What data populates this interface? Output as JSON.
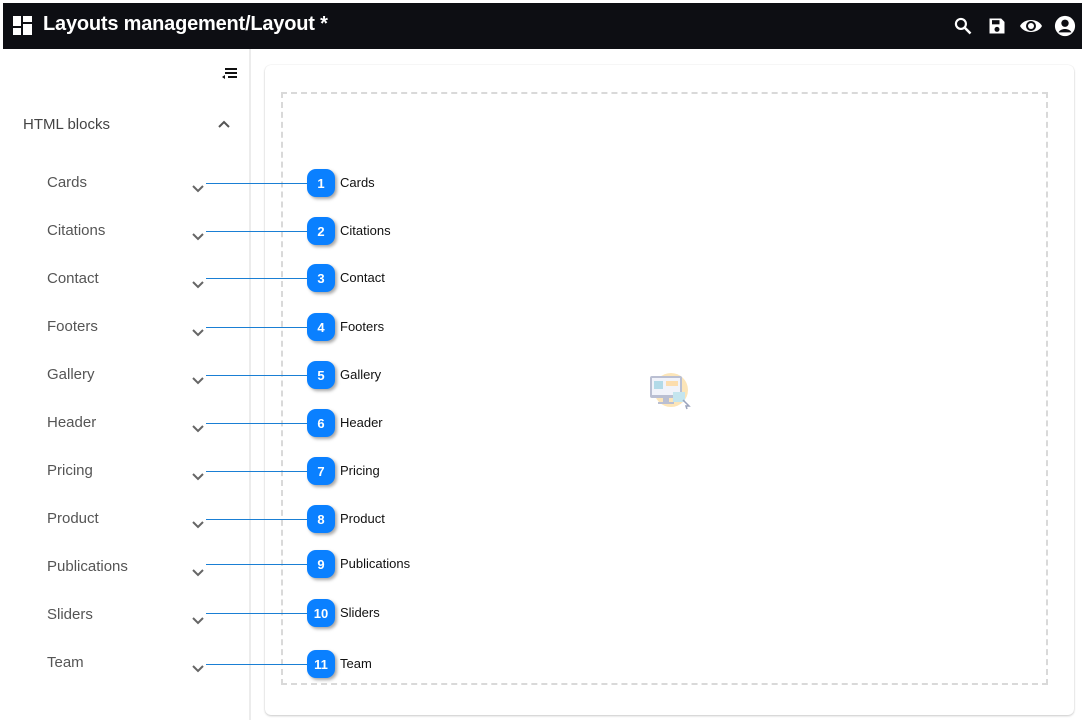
{
  "header": {
    "title": "Layouts management/Layout *",
    "icons": [
      "dashboard-icon",
      "search-icon",
      "save-icon",
      "preview-eye-icon",
      "account-icon"
    ]
  },
  "sidebar": {
    "group": {
      "label": "HTML blocks",
      "expanded": true
    },
    "items": [
      {
        "label": "Cards"
      },
      {
        "label": "Citations"
      },
      {
        "label": "Contact"
      },
      {
        "label": "Footers"
      },
      {
        "label": "Gallery"
      },
      {
        "label": "Header"
      },
      {
        "label": "Pricing"
      },
      {
        "label": "Product"
      },
      {
        "label": "Publications"
      },
      {
        "label": "Sliders"
      },
      {
        "label": "Team"
      }
    ]
  },
  "callouts": [
    {
      "number": "1",
      "text": "Cards"
    },
    {
      "number": "2",
      "text": "Citations"
    },
    {
      "number": "3",
      "text": "Contact"
    },
    {
      "number": "4",
      "text": "Footers"
    },
    {
      "number": "5",
      "text": "Gallery"
    },
    {
      "number": "6",
      "text": "Header"
    },
    {
      "number": "7",
      "text": "Pricing"
    },
    {
      "number": "8",
      "text": "Product"
    },
    {
      "number": "9",
      "text": "Publications"
    },
    {
      "number": "10",
      "text": "Sliders"
    },
    {
      "number": "11",
      "text": "Team"
    }
  ],
  "colors": {
    "topbar": "#0d0e13",
    "badge": "#0a80ff",
    "callout_line": "#1a7fd4"
  }
}
